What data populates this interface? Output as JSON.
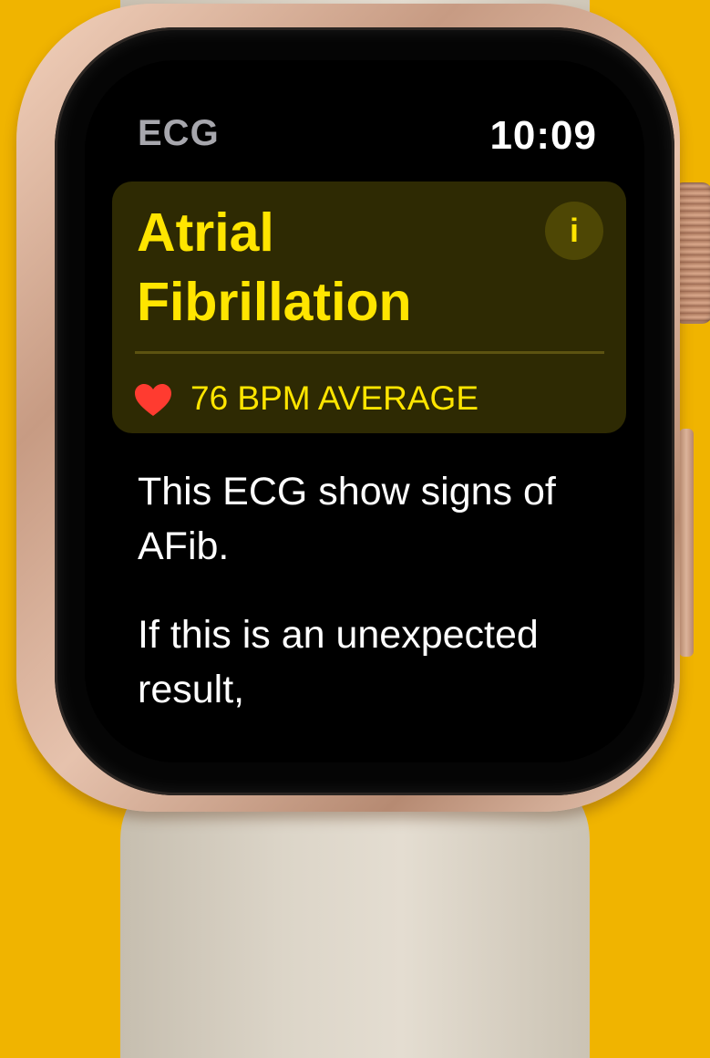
{
  "header": {
    "app_title": "ECG",
    "time": "10:09"
  },
  "result_card": {
    "title": "Atrial Fibrillation",
    "info_button_label": "i",
    "heart_icon": "heart-icon",
    "heart_rate_label": "76 BPM AVERAGE",
    "accent_color": "#ffe500",
    "heart_color": "#ff3b30"
  },
  "body": {
    "message": "This ECG show signs of AFib.",
    "followup": "If this is an unexpected result,"
  },
  "colors": {
    "background": "#f0b400",
    "screen": "#000000"
  }
}
